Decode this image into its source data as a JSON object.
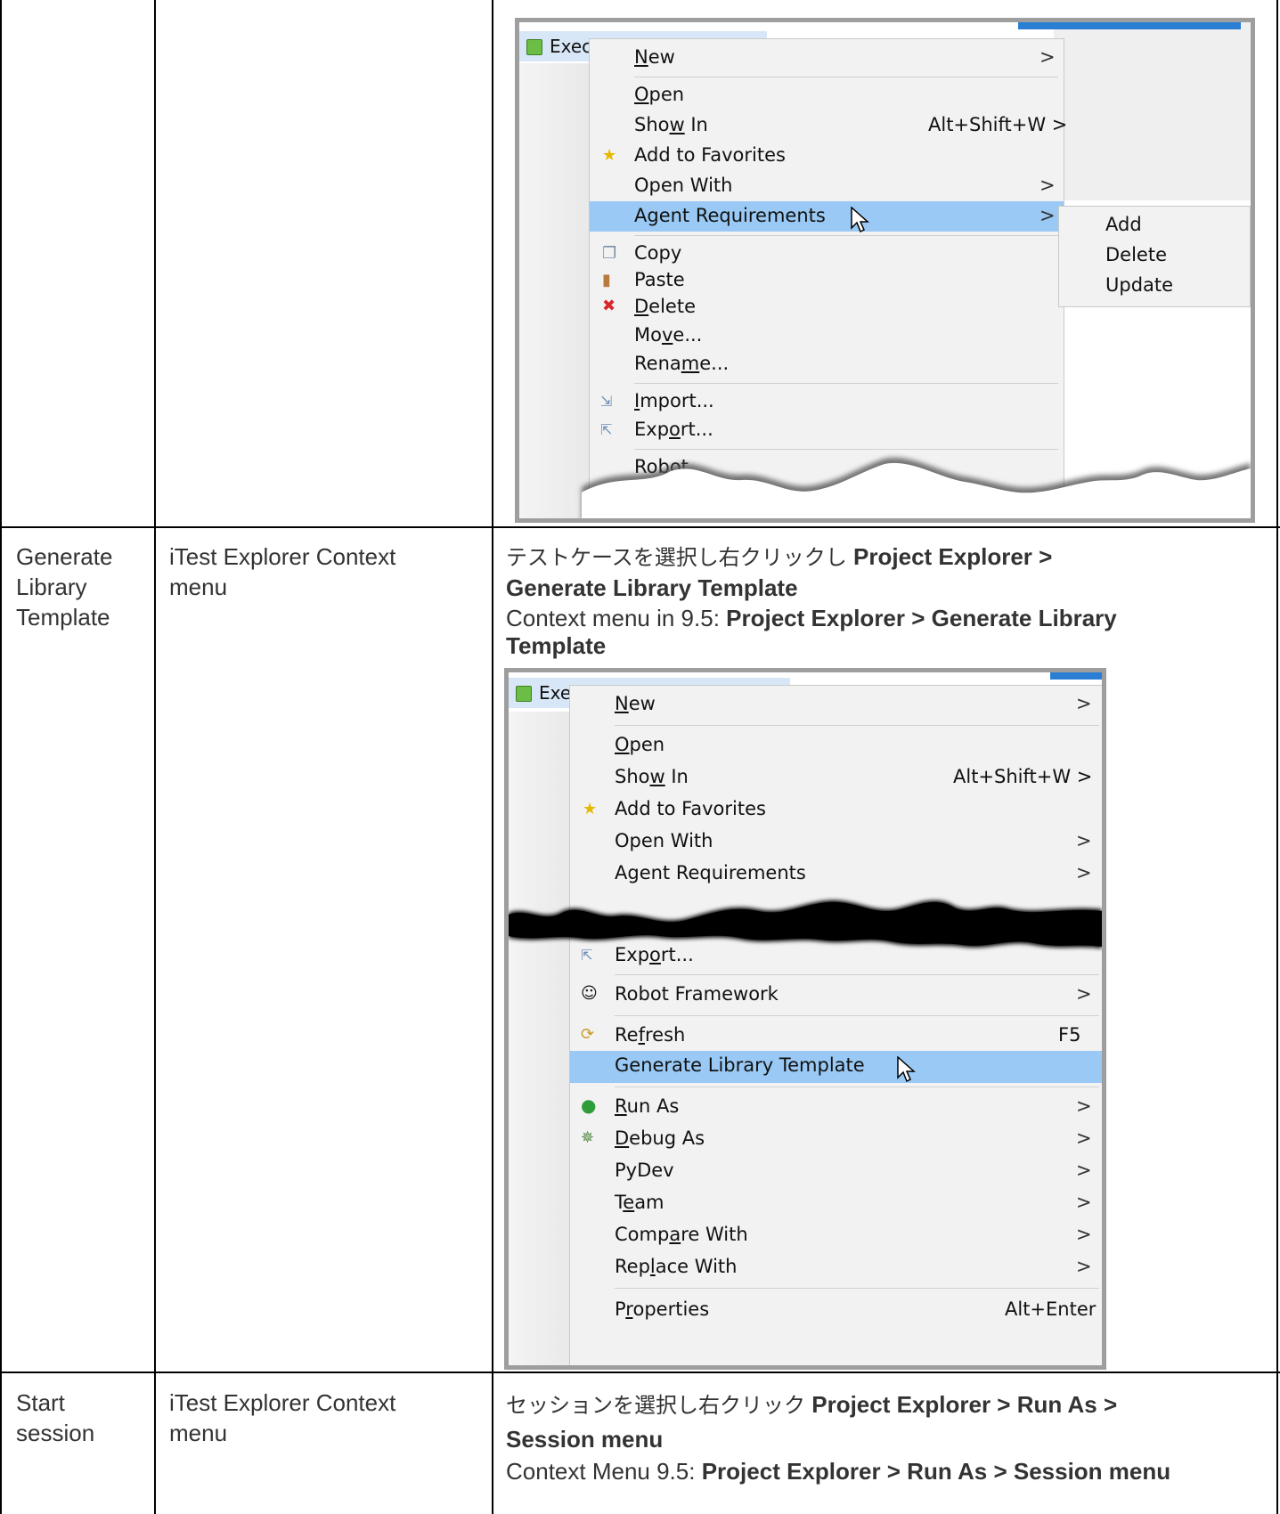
{
  "rows": [
    {
      "command": "",
      "location": "",
      "desc_lines": []
    },
    {
      "command": [
        "Generate",
        "Library",
        "Template"
      ],
      "location": [
        "iTest Explorer Context",
        "menu"
      ],
      "desc_jp": "テストケースを選択し右クリックし",
      "desc_jp_bold": "Project Explorer >",
      "desc_jp_bold2": "Generate Library Template",
      "desc_en": "Context menu in 9.5:",
      "desc_en_bold": "Project Explorer > Generate Library",
      "desc_en_bold2": "Template"
    },
    {
      "command": [
        "Start",
        "session"
      ],
      "location": [
        "iTest Explorer Context",
        "menu"
      ],
      "desc_jp": "セッションを選択し右クリック",
      "desc_jp_bold": "Project Explorer > Run As >",
      "desc_jp_bold2": "Session menu",
      "desc_en": "Context Menu 9.5:",
      "desc_en_bold": "Project Explorer > Run As > Session menu"
    }
  ],
  "shot1": {
    "tree_item": "Exec",
    "menu": [
      {
        "label": "New",
        "arrow": ">"
      },
      {
        "label": "Open"
      },
      {
        "label": "Show In",
        "shortcut": "Alt+Shift+W >"
      },
      {
        "label": "Add to Favorites",
        "icon": "star-icon"
      },
      {
        "label": "Open With",
        "arrow": ">"
      },
      {
        "label": "Agent Requirements",
        "arrow": ">",
        "highlight": true
      },
      {
        "label": "Copy",
        "icon": "copy-icon"
      },
      {
        "label": "Paste",
        "icon": "paste-icon"
      },
      {
        "label": "Delete",
        "icon": "delete-icon"
      },
      {
        "label": "Move..."
      },
      {
        "label": "Rename..."
      },
      {
        "label": "Import...",
        "icon": "import-icon"
      },
      {
        "label": "Export...",
        "icon": "export-icon"
      },
      {
        "label": "Robot"
      }
    ],
    "submenu": [
      "Add",
      "Delete",
      "Update"
    ]
  },
  "shot2": {
    "tree_item": "Exe",
    "menu": [
      {
        "label": "New",
        "arrow": ">"
      },
      {
        "label": "Open"
      },
      {
        "label": "Show In",
        "shortcut": "Alt+Shift+W >"
      },
      {
        "label": "Add to Favorites"
      },
      {
        "label": "Open With",
        "arrow": ">"
      },
      {
        "label": "Agent Requirements",
        "arrow": ">"
      },
      {
        "label": "Export..."
      },
      {
        "label": "Robot Framework",
        "arrow": ">"
      },
      {
        "label": "Refresh",
        "shortcut": "F5"
      },
      {
        "label": "Generate Library Template",
        "highlight": true
      },
      {
        "label": "Run As",
        "arrow": ">"
      },
      {
        "label": "Debug As",
        "arrow": ">"
      },
      {
        "label": "PyDev",
        "arrow": ">"
      },
      {
        "label": "Team",
        "arrow": ">"
      },
      {
        "label": "Compare With",
        "arrow": ">"
      },
      {
        "label": "Replace With",
        "arrow": ">"
      },
      {
        "label": "Properties",
        "shortcut": "Alt+Enter"
      }
    ]
  }
}
